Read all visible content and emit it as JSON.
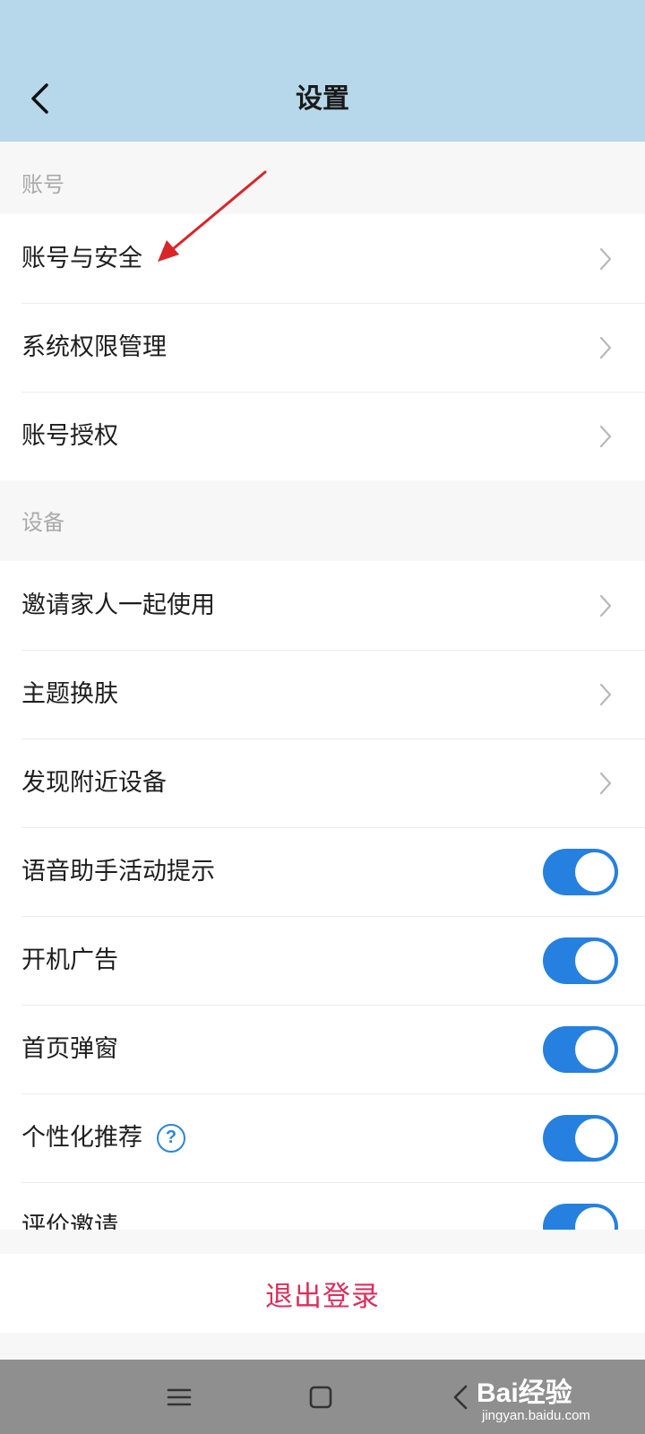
{
  "header": {
    "title": "设置"
  },
  "sections": [
    {
      "label": "账号",
      "items": [
        {
          "label": "账号与安全",
          "type": "link"
        },
        {
          "label": "系统权限管理",
          "type": "link"
        },
        {
          "label": "账号授权",
          "type": "link"
        }
      ]
    },
    {
      "label": "设备",
      "items": [
        {
          "label": "邀请家人一起使用",
          "type": "link"
        },
        {
          "label": "主题换肤",
          "type": "link"
        },
        {
          "label": "发现附近设备",
          "type": "link"
        },
        {
          "label": "语音助手活动提示",
          "type": "toggle",
          "on": true
        },
        {
          "label": "开机广告",
          "type": "toggle",
          "on": true
        },
        {
          "label": "首页弹窗",
          "type": "toggle",
          "on": true
        },
        {
          "label": "个性化推荐",
          "type": "toggle",
          "on": true,
          "help_icon": "question-circle-icon"
        },
        {
          "label": "评价邀请",
          "type": "toggle",
          "on": true
        }
      ]
    }
  ],
  "logout": {
    "label": "退出登录"
  },
  "navbar": {
    "buttons": [
      "menu-icon",
      "home-square-icon",
      "back-triangle-icon"
    ]
  },
  "watermark": {
    "main": "Bai经验",
    "sub": "jingyan.baidu.com"
  },
  "colors": {
    "header_bg": "#b6d8ea",
    "toggle_on": "#2680df",
    "logout_text": "#d8305c",
    "annotation_arrow": "#d8262a"
  }
}
